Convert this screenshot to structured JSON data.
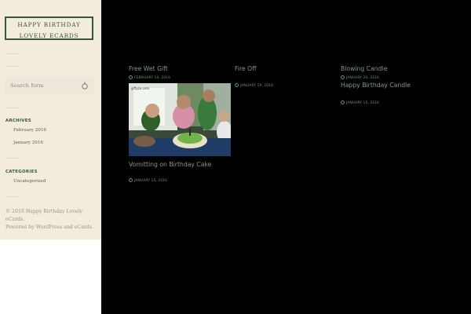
{
  "site": {
    "title_line1": "HAPPY BIRTHDAY",
    "title_line2": "LOVELY ECARDS"
  },
  "search": {
    "placeholder": "Search form"
  },
  "archives": {
    "title": "ARCHIVES",
    "items": [
      "February 2016",
      "January 2016"
    ]
  },
  "categories": {
    "title": "CATEGORIES",
    "items": [
      "Uncategorized"
    ]
  },
  "footer": {
    "line1": "© 2016 Happy Birthday Lovely eCards.",
    "line2": "Powered by WordPress and eCards."
  },
  "posts": [
    {
      "title": "Free Wet Gift",
      "date": "FEBRUARY 14, 2016"
    },
    {
      "title": "Fire Off",
      "date": "JANUARY 29, 2016"
    },
    {
      "title": "Blowing Candle",
      "date": "JANUARY 20, 2016"
    },
    {
      "title": "Happy Birthday Candle",
      "date": "JANUARY 15, 2016"
    },
    {
      "title": "Vomitting on Birthday Cake",
      "date": "JANUARY 15, 2016"
    }
  ],
  "thumbnail": {
    "watermark": "giftyze.com"
  },
  "colors": {
    "sidebar_bg": "#f3ecdc",
    "brand": "#345744",
    "post_title": "#7f9a86",
    "page_bg": "#000000"
  },
  "icons": {
    "search": "search-icon",
    "date": "clock-icon"
  }
}
